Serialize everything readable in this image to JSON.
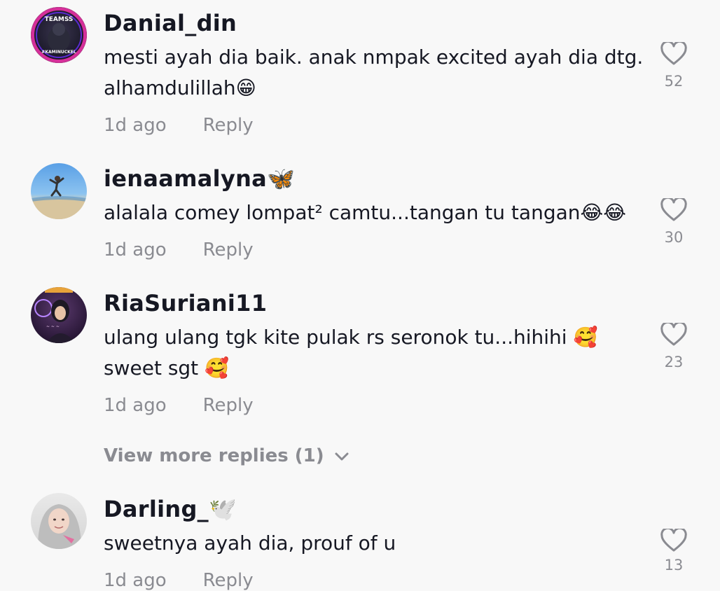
{
  "comments": [
    {
      "username": "Danial_din",
      "text_line1": "mesti ayah dia baik. anak nmpak excited ayah dia dtg.",
      "text_line2": "alhamdulillah😁",
      "time": "1d ago",
      "reply": "Reply",
      "likes": "52",
      "avatar_text": "TEAMSS",
      "avatar_text2": "#KAMINUCKEL"
    },
    {
      "username": "ienaamalyna🦋",
      "text_line1": "alalala comey lompat² camtu...tangan tu tangan😂😂",
      "time": "1d ago",
      "reply": "Reply",
      "likes": "30"
    },
    {
      "username": "RiaSuriani11",
      "text_line1": "ulang ulang tgk kite pulak rs seronok tu...hihihi 🥰",
      "text_line2": "sweet sgt 🥰",
      "time": "1d ago",
      "reply": "Reply",
      "likes": "23"
    },
    {
      "username": "Darling_🕊️",
      "text_line1": "sweetnya ayah dia, prouf of u",
      "time": "1d ago",
      "reply": "Reply",
      "likes": "13"
    }
  ],
  "view_more_replies": "View more replies (1)",
  "colors": {
    "background": "#f8f8f8",
    "primary_text": "#161823",
    "secondary_text": "#8a8b91"
  },
  "icons": [
    "heart-icon",
    "chevron-down-icon"
  ]
}
